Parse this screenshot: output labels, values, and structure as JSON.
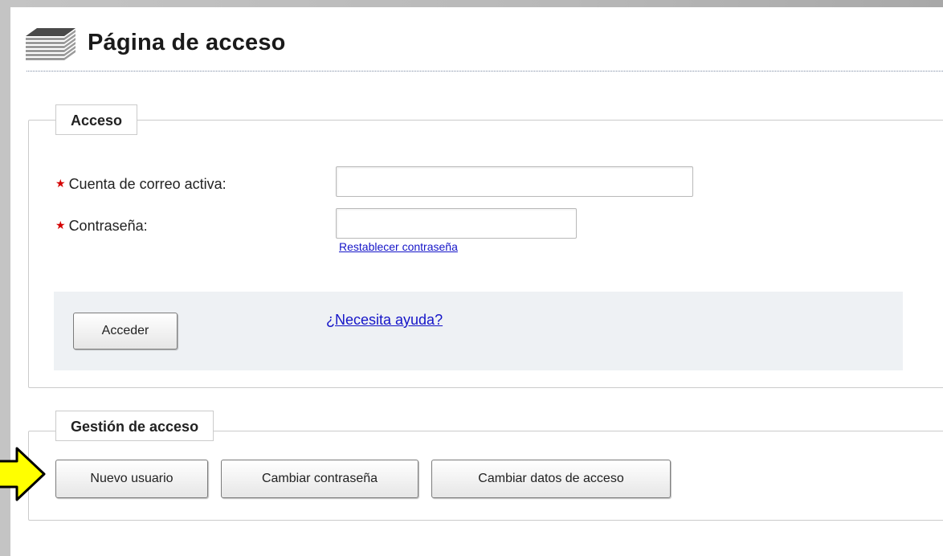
{
  "page": {
    "title": "Página de acceso"
  },
  "login": {
    "legend": "Acceso",
    "required_marker": "★",
    "email_label": "Cuenta de correo activa:",
    "email_value": "",
    "password_label": "Contraseña:",
    "password_value": "",
    "reset_link": "Restablecer contraseña",
    "submit_button": "Acceder",
    "help_link": "¿Necesita ayuda?"
  },
  "access_management": {
    "legend": "Gestión de acceso",
    "buttons": {
      "new_user": "Nuevo usuario",
      "change_password": "Cambiar contraseña",
      "change_access_data": "Cambiar datos de acceso"
    }
  },
  "icons": {
    "title": "stacked-pages-icon",
    "pointer": "arrow-right-icon",
    "required": "star-icon"
  },
  "colors": {
    "required_star": "#d40000",
    "link": "#1515c8",
    "action_band": "#eef1f4",
    "pointer_arrow": "#ffff00"
  }
}
